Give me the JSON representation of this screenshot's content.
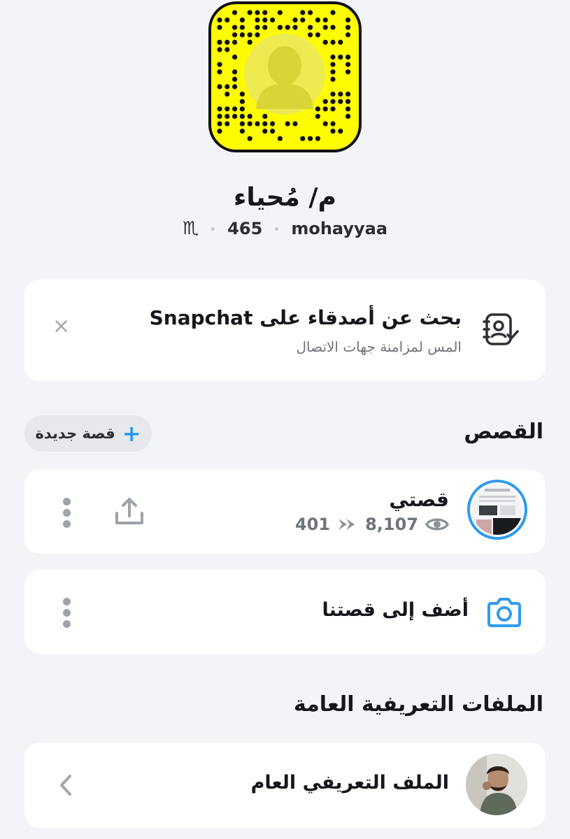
{
  "profile": {
    "display_name": "م/ مُحياء",
    "username": "mohayyaa",
    "score": "465",
    "zodiac_symbol": "♏"
  },
  "find_friends": {
    "title": "بحث عن أصدقاء على Snapchat",
    "subtitle": "المس لمزامنة جهات الاتصال",
    "dismiss_symbol": "×"
  },
  "stories": {
    "section_title": "القصص",
    "new_story_label": "قصة جديدة",
    "my_story": {
      "title": "قصتي",
      "views": "8,107",
      "screenshots": "401"
    },
    "add_to_our_story_label": "أضف إلى قصتنا"
  },
  "public_profiles": {
    "section_title": "الملفات التعريفية العامة",
    "item_label": "الملف التعريفي العام"
  },
  "colors": {
    "accent_blue": "#2f9bf0",
    "snap_yellow": "#fffc00"
  }
}
